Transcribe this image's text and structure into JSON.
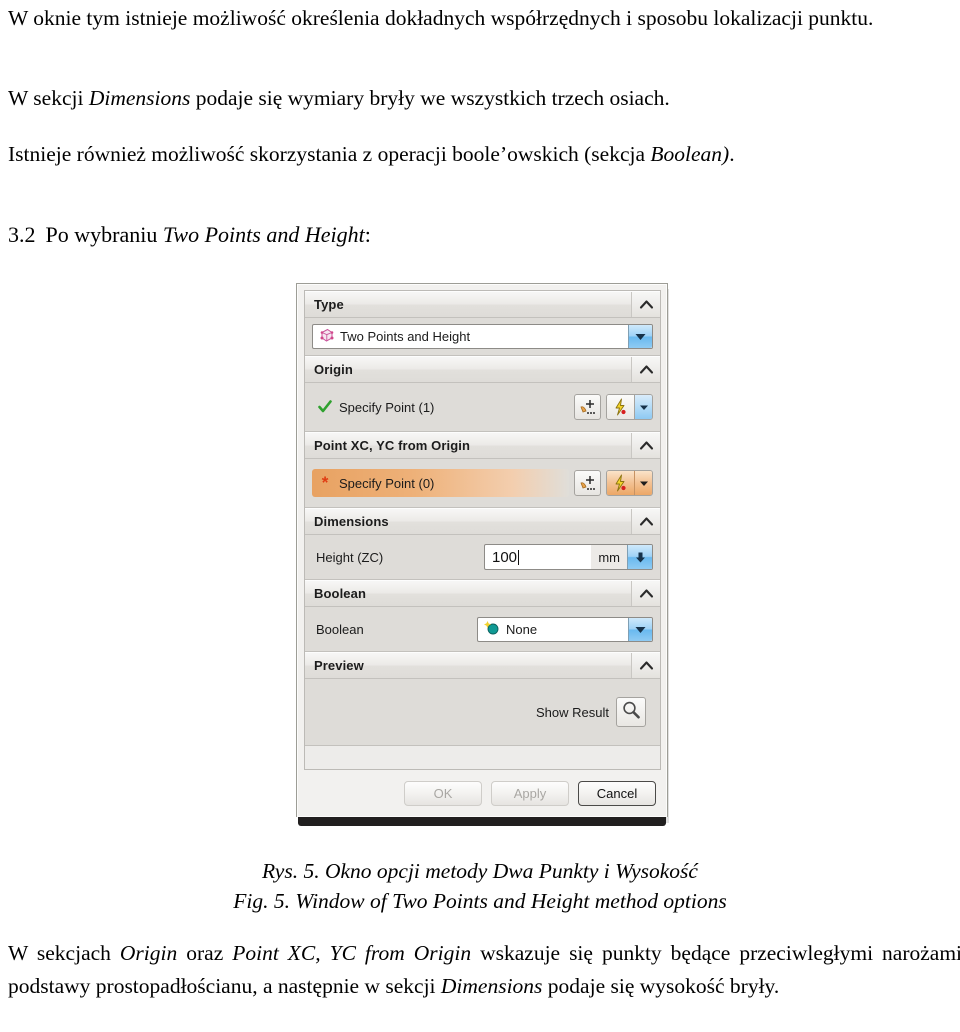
{
  "document": {
    "paragraph_1": "W oknie tym istnieje możliwość określenia dokładnych współrzędnych i sposobu lokalizacji punktu.",
    "paragraph_2_pre": "W sekcji ",
    "paragraph_2_em": "Dimensions",
    "paragraph_2_post": " podaje się wymiary bryły we wszystkich trzech osiach.",
    "paragraph_3_pre": "Istnieje również możliwość skorzystania z operacji boole’owskich (sekcja ",
    "paragraph_3_em": "Boolean)",
    "paragraph_3_post": ".",
    "heading_number": "3.2",
    "heading_pre": "Po wybraniu ",
    "heading_em": "Two Points and Height",
    "heading_post": ":",
    "caption_line_1": "Rys. 5. Okno opcji metody Dwa Punkty i Wysokość",
    "caption_line_2": "Fig. 5. Window of Two Points and Height method options",
    "paragraph_4_a": "W sekcjach ",
    "paragraph_4_em1": "Origin",
    "paragraph_4_b": " oraz ",
    "paragraph_4_em2": "Point XC, YC from Origin",
    "paragraph_4_c": " wskazuje się punkty będące przeciwległymi narożami podstawy prostopadłościanu, a następnie w sekcji ",
    "paragraph_4_em3": "Dimensions",
    "paragraph_4_d": " podaje się wysokość bryły."
  },
  "dialog": {
    "sections": {
      "type": {
        "title": "Type",
        "collapse_icon": "chevron-up-icon",
        "combo_value": "Two Points and Height",
        "combo_icon": "block-cube-icon",
        "dropdown_icon": "chevron-down-icon"
      },
      "origin": {
        "title": "Origin",
        "collapse_icon": "chevron-up-icon",
        "point_label": "Specify Point (1)",
        "status_icon": "green-check-icon",
        "point_constructor_icon": "point-constructor-icon",
        "snap_icon": "snap-point-lightning-icon",
        "snap_dropdown_icon": "chevron-down-icon"
      },
      "point_xc_yc": {
        "title": "Point XC, YC from Origin",
        "collapse_icon": "chevron-up-icon",
        "point_label": "Specify Point (0)",
        "status_icon": "red-asterisk-icon",
        "point_constructor_icon": "point-constructor-icon",
        "snap_icon": "snap-point-lightning-icon",
        "snap_dropdown_icon": "chevron-down-icon"
      },
      "dimensions": {
        "title": "Dimensions",
        "collapse_icon": "chevron-up-icon",
        "height_label": "Height (ZC)",
        "height_value": "100",
        "height_unit": "mm",
        "stepper_icon": "down-arrow-icon"
      },
      "boolean": {
        "title": "Boolean",
        "collapse_icon": "chevron-up-icon",
        "field_label": "Boolean",
        "value": "None",
        "value_icon": "boolean-none-icon",
        "dropdown_icon": "chevron-down-icon"
      },
      "preview": {
        "title": "Preview",
        "collapse_icon": "chevron-up-icon",
        "show_result_label": "Show Result",
        "show_result_icon": "magnifier-icon"
      }
    },
    "footer": {
      "ok_label": "OK",
      "apply_label": "Apply",
      "cancel_label": "Cancel"
    }
  },
  "colors": {
    "active_row_orange": "#eeb179",
    "dropdown_blue": "#69b9ef",
    "check_green": "#2fa12f",
    "asterisk_red": "#e03b12",
    "cube_icon_pink": "#d0468a",
    "boolean_icon_teal": "#0f9a94",
    "dialog_panel": "#dedcd8",
    "dialog_shadow": "#211f1f"
  }
}
